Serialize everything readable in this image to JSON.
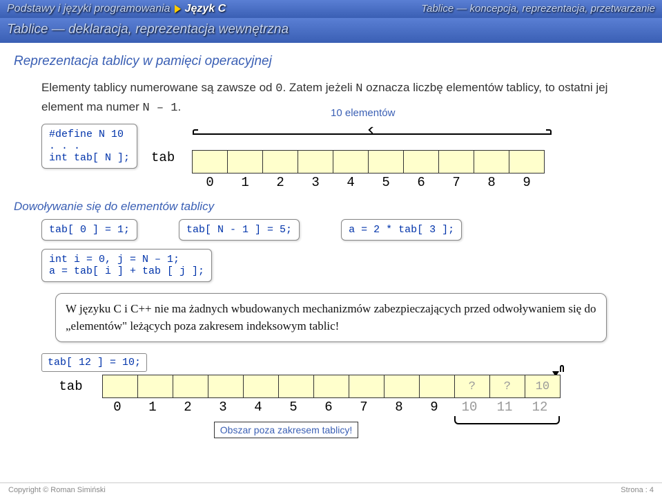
{
  "header": {
    "category1": "Podstawy i języki programowania",
    "category2": "Język C",
    "category3": "Tablice — koncepcja, reprezentacja, przetwarzanie"
  },
  "subheader": "Tablice — deklaracja, reprezentacja wewnętrzna",
  "slide_title": "Reprezentacja tablicy w pamięci operacyjnej",
  "body1_a": "Elementy tablicy numerowane są zawsze od ",
  "body1_b": "0",
  "body1_c": ". Zatem jeżeli ",
  "body1_d": "N",
  "body1_e": " oznacza liczbę elementów tablicy, to ostatni jej element ma numer ",
  "body1_f": "N – 1",
  "body1_g": ".",
  "code_define": "#define N 10\n. . .\nint tab[ N ];",
  "ten_elem": "10 elementów",
  "tab_label": "tab",
  "indices": [
    "0",
    "1",
    "2",
    "3",
    "4",
    "5",
    "6",
    "7",
    "8",
    "9"
  ],
  "subtitle": "Dowoływanie się do elementów tablicy",
  "code_a": "tab[ 0 ] = 1;",
  "code_b": "tab[ N - 1 ] = 5;",
  "code_c": "a = 2 * tab[ 3 ];",
  "code_d": "int i = 0, j = N – 1;\na = tab[ i ] + tab [ j ];",
  "note": "W języku C i C++ nie ma żadnych wbudowanych mechanizmów zabezpieczających przed odwoływaniem się do „elementów\" leżących poza zakresem indeksowym tablic!",
  "code_e": "tab[ 12 ] = 10;",
  "tab2_label": "tab",
  "cells2": [
    "",
    "",
    "",
    "",
    "",
    "",
    "",
    "",
    "",
    "",
    "?",
    "?",
    "10"
  ],
  "indices2": [
    "0",
    "1",
    "2",
    "3",
    "4",
    "5",
    "6",
    "7",
    "8",
    "9",
    "10",
    "11",
    "12"
  ],
  "oob_label": "Obszar poza zakresem tablicy!",
  "footer_left": "Copyright © Roman Simiński",
  "footer_right": "Strona : 4"
}
